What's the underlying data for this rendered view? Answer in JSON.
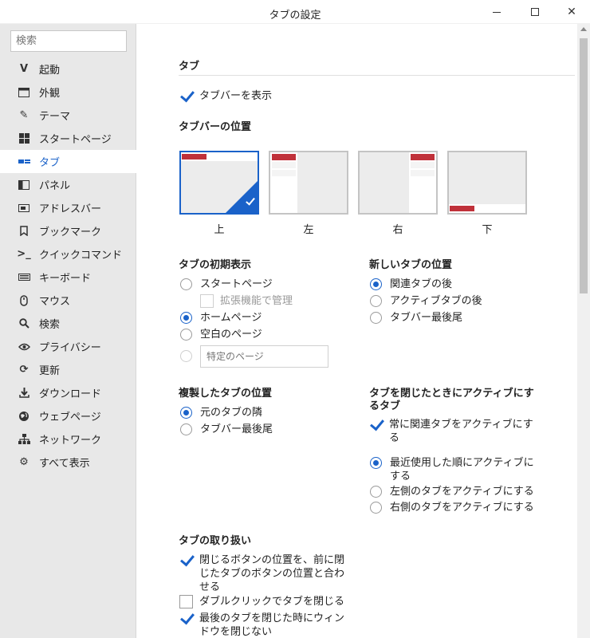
{
  "window": {
    "title": "タブの設定"
  },
  "sidebar": {
    "search_placeholder": "検索",
    "items": [
      {
        "label": "起動",
        "icon": "v-icon"
      },
      {
        "label": "外観",
        "icon": "window-icon"
      },
      {
        "label": "テーマ",
        "icon": "brush-icon"
      },
      {
        "label": "スタートページ",
        "icon": "grid-icon"
      },
      {
        "label": "タブ",
        "icon": "tab-icon",
        "active": true
      },
      {
        "label": "パネル",
        "icon": "panel-icon"
      },
      {
        "label": "アドレスバー",
        "icon": "address-bar-icon"
      },
      {
        "label": "ブックマーク",
        "icon": "bookmark-icon"
      },
      {
        "label": "クイックコマンド",
        "icon": "quick-command-icon"
      },
      {
        "label": "キーボード",
        "icon": "keyboard-icon"
      },
      {
        "label": "マウス",
        "icon": "mouse-icon"
      },
      {
        "label": "検索",
        "icon": "search-icon"
      },
      {
        "label": "プライバシー",
        "icon": "eye-icon"
      },
      {
        "label": "更新",
        "icon": "refresh-icon"
      },
      {
        "label": "ダウンロード",
        "icon": "download-icon"
      },
      {
        "label": "ウェブページ",
        "icon": "globe-icon"
      },
      {
        "label": "ネットワーク",
        "icon": "network-icon"
      },
      {
        "label": "すべて表示",
        "icon": "gear-icon"
      }
    ]
  },
  "main": {
    "section_title": "タブ",
    "show_tabbar": {
      "label": "タブバーを表示",
      "checked": true
    },
    "tabbar_position": {
      "title": "タブバーの位置",
      "options": [
        "上",
        "左",
        "右",
        "下"
      ],
      "selected": "上"
    },
    "initial_display": {
      "title": "タブの初期表示",
      "start_page": "スタートページ",
      "extension_managed": "拡張機能で管理",
      "home_page": "ホームページ",
      "blank_page": "空白のページ",
      "specific_page_placeholder": "特定のページ",
      "selected": "ホームページ"
    },
    "new_tab_position": {
      "title": "新しいタブの位置",
      "options": [
        "関連タブの後",
        "アクティブタブの後",
        "タブバー最後尾"
      ],
      "selected": "関連タブの後"
    },
    "duplicate_position": {
      "title": "複製したタブの位置",
      "options": [
        "元のタブの隣",
        "タブバー最後尾"
      ],
      "selected": "元のタブの隣"
    },
    "on_close": {
      "title_line1": "タブを閉じたときにアクティブにす",
      "title_line2": "るタブ",
      "always_related_line1": "常に関連タブをアクティブにす",
      "always_related_line2": "る",
      "recent_line1": "最近使用した順にアクティブに",
      "recent_line2": "する",
      "left": "左側のタブをアクティブにする",
      "right": "右側のタブをアクティブにする",
      "selected": "最近使用した順にアクティブにする"
    },
    "handling": {
      "title": "タブの取り扱い",
      "close_button_line1": "閉じるボタンの位置を、前に閉",
      "close_button_line2": "じたタブのボタンの位置と合わ",
      "close_button_line3": "せる",
      "double_click": "ダブルクリックでタブを閉じる",
      "last_tab_line1": "最後のタブを閉じた時にウィン",
      "last_tab_line2": "ドウを閉じない"
    }
  },
  "colors": {
    "accent": "#1a62c9",
    "tab_red": "#c0313a",
    "sidebar_bg": "#e8e8e8"
  }
}
